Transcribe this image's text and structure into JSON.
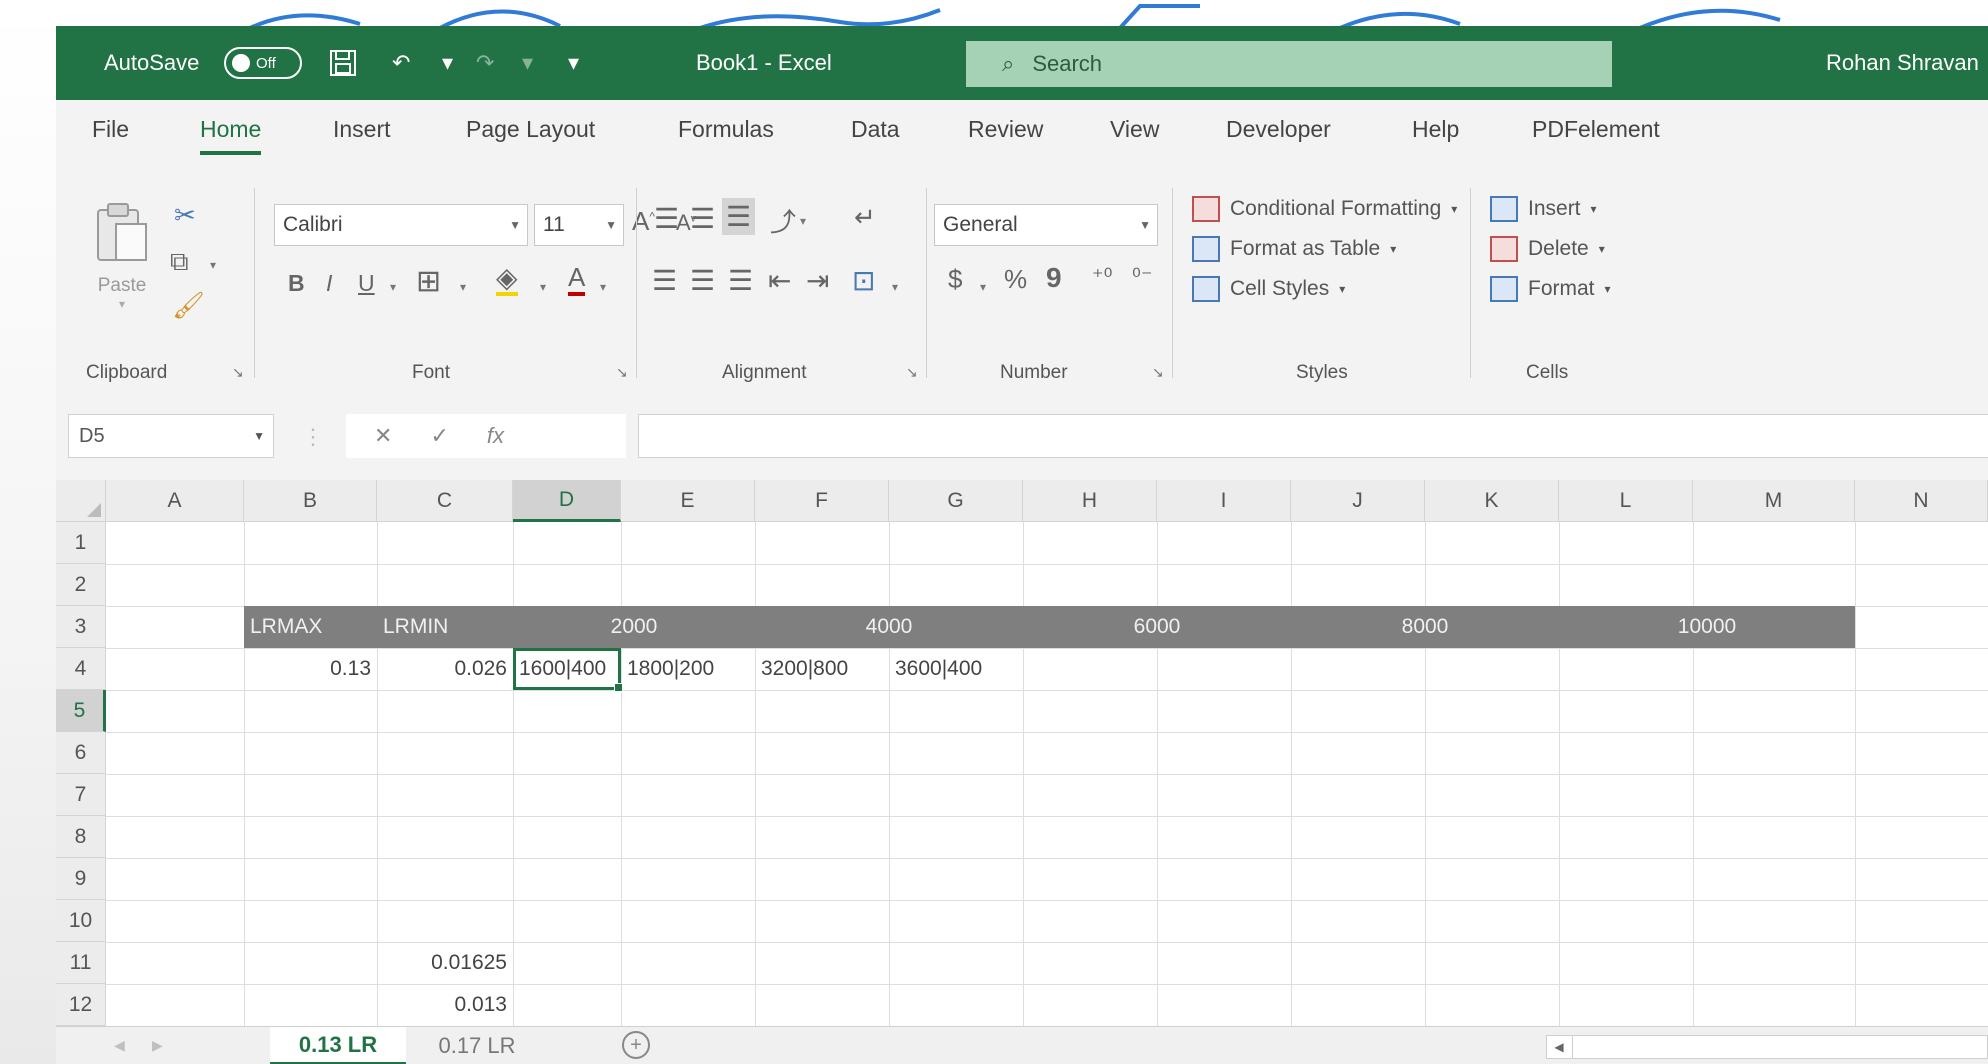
{
  "titlebar": {
    "autosave_label": "AutoSave",
    "autosave_state": "Off",
    "document_title": "Book1  -  Excel",
    "search_placeholder": "Search",
    "user_name": "Rohan Shravan"
  },
  "tabs": [
    "File",
    "Home",
    "Insert",
    "Page Layout",
    "Formulas",
    "Data",
    "Review",
    "View",
    "Developer",
    "Help",
    "PDFelement"
  ],
  "active_tab": "Home",
  "ribbon": {
    "clipboard": {
      "paste_label": "Paste",
      "group_label": "Clipboard"
    },
    "font": {
      "font_name": "Calibri",
      "font_size": "11",
      "group_label": "Font",
      "bold": "B",
      "italic": "I",
      "underline": "U",
      "font_color": "A"
    },
    "alignment": {
      "group_label": "Alignment"
    },
    "number": {
      "format": "General",
      "group_label": "Number",
      "currency": "$",
      "percent": "%",
      "comma": "9"
    },
    "styles": {
      "conditional_formatting": "Conditional Formatting",
      "format_as_table": "Format as Table",
      "cell_styles": "Cell Styles",
      "group_label": "Styles"
    },
    "cells": {
      "insert": "Insert",
      "delete": "Delete",
      "format": "Format",
      "group_label": "Cells"
    }
  },
  "formula_bar": {
    "name_box": "D5",
    "fx_label": "fx",
    "formula": ""
  },
  "grid": {
    "columns": [
      "A",
      "B",
      "C",
      "D",
      "E",
      "F",
      "G",
      "H",
      "I",
      "J",
      "K",
      "L",
      "M",
      "N"
    ],
    "rows": [
      "1",
      "2",
      "3",
      "4",
      "5",
      "6",
      "7",
      "8",
      "9",
      "10",
      "11",
      "12"
    ],
    "selected_column": "D",
    "selected_row": "5",
    "header_row": {
      "B3": "LRMAX",
      "C3": "LRMIN",
      "D3_E3": "2000",
      "F3_G3": "4000",
      "H3_I3": "6000",
      "J3_K3": "8000",
      "L3_M3": "10000"
    },
    "row4": {
      "B4": "0.13",
      "C4": "0.026",
      "D4": "1600|400",
      "E4": "1800|200",
      "F4": "3200|800",
      "G4": "3600|400"
    },
    "C11": "0.01625",
    "C12": "0.013"
  },
  "sheets": [
    "0.13 LR",
    "0.17 LR"
  ],
  "active_sheet": "0.13 LR",
  "colors": {
    "excel_green": "#217346",
    "band_gray": "#7f7f7f",
    "search_bg": "#a5d2b5"
  }
}
